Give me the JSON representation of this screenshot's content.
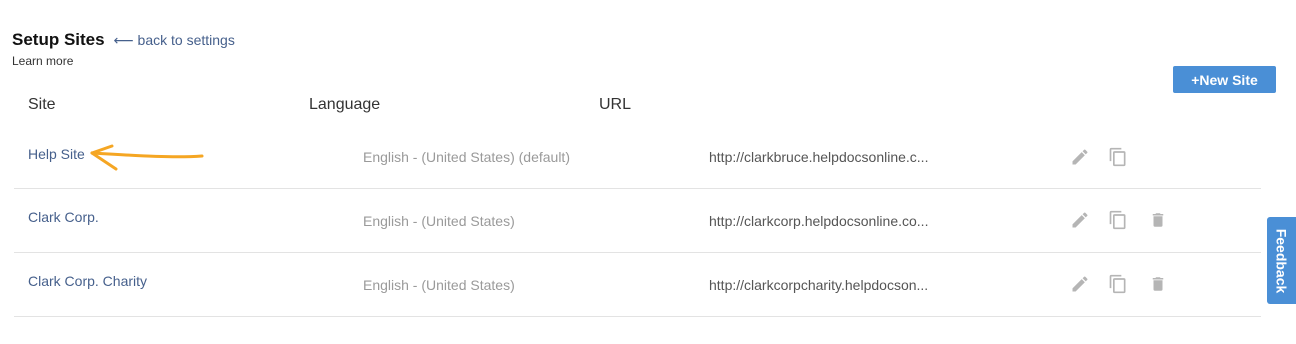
{
  "header": {
    "title": "Setup Sites",
    "back_link": "⟵ back to settings",
    "learn_more": "Learn more"
  },
  "toolbar": {
    "new_site_label": "+New Site"
  },
  "table": {
    "columns": [
      "Site",
      "Language",
      "URL"
    ],
    "rows": [
      {
        "site": "Help Site",
        "language": "English - (United States) (default)",
        "url": "http://clarkbruce.helpdocsonline.c...",
        "actions": [
          "edit-icon",
          "copy-icon"
        ]
      },
      {
        "site": "Clark Corp.",
        "language": "English - (United States)",
        "url": "http://clarkcorp.helpdocsonline.co...",
        "actions": [
          "edit-icon",
          "copy-icon",
          "trash-icon"
        ]
      },
      {
        "site": "Clark Corp. Charity",
        "language": "English - (United States)",
        "url": "http://clarkcorpcharity.helpdocson...",
        "actions": [
          "edit-icon",
          "copy-icon",
          "trash-icon"
        ]
      }
    ]
  },
  "feedback": {
    "label": "Feedback"
  },
  "colors": {
    "accent": "#4a8fd6",
    "link": "#46608c",
    "annotation_arrow": "#f5a623",
    "icon": "#b5b5b5"
  }
}
